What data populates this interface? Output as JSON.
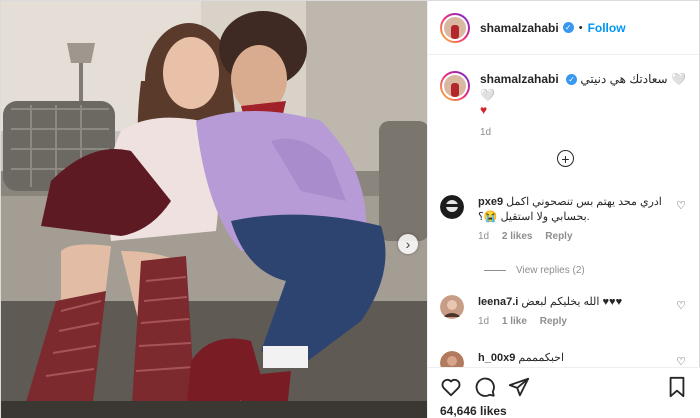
{
  "post": {
    "username": "shamalzahabi",
    "follow_label": "Follow",
    "separator": "•",
    "caption_text": "سعادتك هي دنيتي 🤍🤍",
    "caption_heart": "♥",
    "caption_time": "1d",
    "likes": "64,646 likes"
  },
  "comments": [
    {
      "username": "pxe9",
      "text": "ادري محد يهتم بس تنصحوني اكمل بحسابي ولا استقيل 😭؟.",
      "time": "1d",
      "likes": "2 likes",
      "reply": "Reply"
    },
    {
      "username": "leena7.i",
      "text": "الله يخليكم لبعض ♥♥♥",
      "time": "1d",
      "likes": "1 like",
      "reply": "Reply"
    },
    {
      "username": "h_00x9",
      "text": "احبكمممم"
    }
  ],
  "view_replies": "View replies (2)",
  "icons": {
    "verified": "✓",
    "comment_heart": "♡",
    "plus": "+",
    "next": "›"
  },
  "colors": {
    "accent": "#0095f6",
    "verified": "#3897f0",
    "muted": "#8e8e8e",
    "heart": "#d3232b"
  }
}
